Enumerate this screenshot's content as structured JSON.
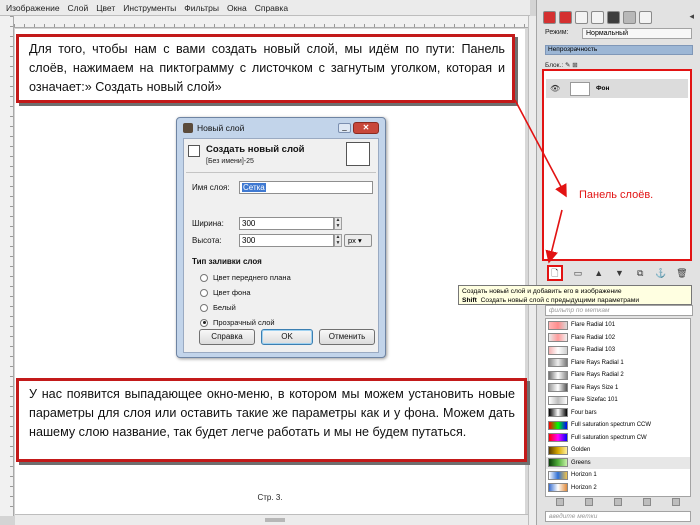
{
  "menubar": [
    "Изображение",
    "Слой",
    "Цвет",
    "Инструменты",
    "Фильтры",
    "Окна",
    "Справка"
  ],
  "callout_top": "Для того, чтобы нам с вами создать новый слой, мы идём по пути: Панель слоёв, нажимаем на пиктограмму с листочком с загнутым уголком, которая и означает:» Создать новый слой»",
  "callout_bottom": "У нас появится выпадающее окно-меню, в котором мы можем установить новые параметры для слоя или оставить такие же параметры как и у фона. Можем дать нашему слою название, так будет легче работать и мы не будем путаться.",
  "page_number": "Стр. 3.",
  "dialog": {
    "window_title": "Новый слой",
    "header_title": "Создать новый слой",
    "header_subtitle": "[Без имени]-25",
    "name_label": "Имя слоя:",
    "name_value": "Сетка",
    "width_label": "Ширина:",
    "width_value": "300",
    "height_label": "Высота:",
    "height_value": "300",
    "unit": "px",
    "fill_title": "Тип заливки слоя",
    "fill_options": [
      "Цвет переднего плана",
      "Цвет фона",
      "Белый",
      "Прозрачный слой"
    ],
    "fill_selected": 3,
    "help_label": "Справка",
    "ok_label": "OK",
    "cancel_label": "Отменить",
    "close_glyph": "✕"
  },
  "dock": {
    "mode_label": "Режим:",
    "mode_value": "Нормальный",
    "opacity_label": "Непрозрачность",
    "lock_label": "Блок.:",
    "layer_name": "Фон",
    "panel_label": "Панель слоёв.",
    "tooltip_line1": "Создать новый слой и добавить его в изображение",
    "tooltip_shift": "Shift",
    "tooltip_line2": "Создать новый слой с предыдущими параметрами",
    "filter_placeholder": "фильтр по меткам",
    "filter2_placeholder": "введите метки",
    "gradients": [
      {
        "name": "Flare Radial 101",
        "colors": [
          "#ffb6b6",
          "#ff8c8c",
          "#d9d9d9"
        ]
      },
      {
        "name": "Flare Radial 102",
        "colors": [
          "#e9e9e9",
          "#ff9b9b",
          "#f1f1f1"
        ]
      },
      {
        "name": "Flare Radial 103",
        "colors": [
          "#f4b2b2",
          "#ffffff",
          "#cfcfcf"
        ]
      },
      {
        "name": "Flare Rays Radial 1",
        "colors": [
          "#888888",
          "#eeeeee",
          "#777777"
        ]
      },
      {
        "name": "Flare Rays Radial 2",
        "colors": [
          "#6f6f6f",
          "#ffffff",
          "#8a8a8a"
        ]
      },
      {
        "name": "Flare Rays Size 1",
        "colors": [
          "#9a9a9a",
          "#ffffff",
          "#555555"
        ]
      },
      {
        "name": "Flare Sizefac 101",
        "colors": [
          "#ffffff",
          "#bdbdbd",
          "#ffffff"
        ]
      },
      {
        "name": "Four bars",
        "colors": [
          "#000000",
          "#ffffff",
          "#000000"
        ]
      },
      {
        "name": "Full saturation spectrum CCW",
        "colors": [
          "#ff0000",
          "#00ff00",
          "#0000ff"
        ]
      },
      {
        "name": "Full saturation spectrum CW",
        "colors": [
          "#ff0000",
          "#ff00ff",
          "#0000ff"
        ]
      },
      {
        "name": "Golden",
        "colors": [
          "#5a3c00",
          "#d7a800",
          "#fff0a0"
        ]
      },
      {
        "name": "Greens",
        "colors": [
          "#0a3d0a",
          "#4fae3a",
          "#c7f0a8"
        ]
      },
      {
        "name": "Horizon 1",
        "colors": [
          "#ffffff",
          "#2f6fd4",
          "#f0c24a"
        ]
      },
      {
        "name": "Horizon 2",
        "colors": [
          "#3a6fd0",
          "#ffffff",
          "#e08a3a"
        ]
      }
    ],
    "selected_gradient": 11
  },
  "colors": {
    "callout_border": "#c31a1a",
    "panel_highlight": "#e21313",
    "dialog_frame": "#c2d4ea"
  }
}
